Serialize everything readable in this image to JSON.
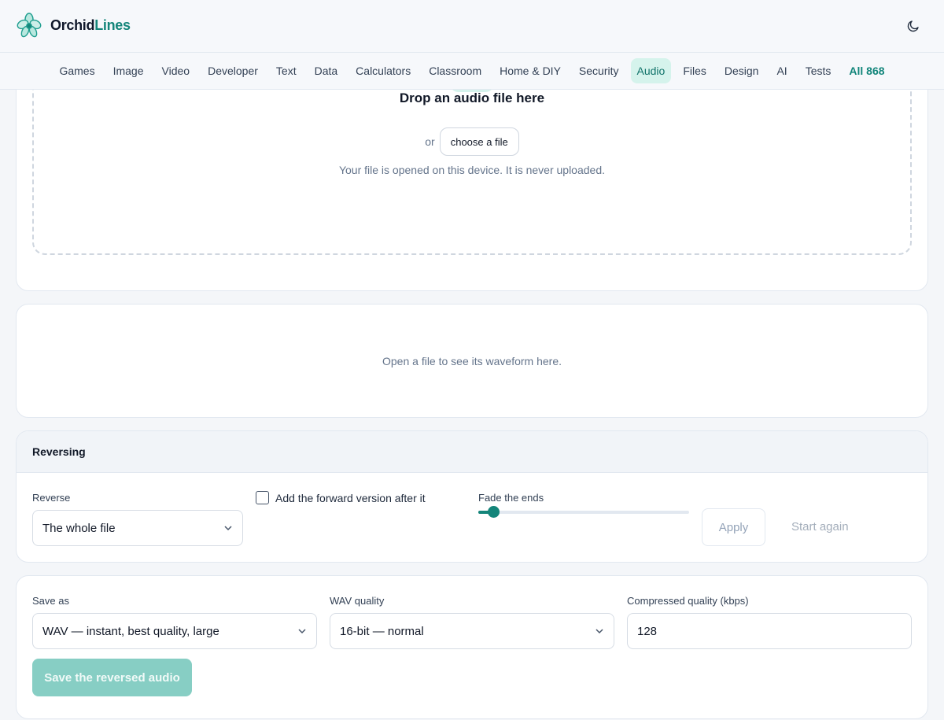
{
  "header": {
    "brand_part1": "Orchid",
    "brand_part2": "Lines",
    "theme_icon": "moon-icon"
  },
  "nav": {
    "items": [
      "Games",
      "Image",
      "Video",
      "Developer",
      "Text",
      "Data",
      "Calculators",
      "Classroom",
      "Home & DIY",
      "Security",
      "Audio",
      "Files",
      "Design",
      "AI",
      "Tests"
    ],
    "active": "Audio",
    "all_label": "All 868"
  },
  "dropzone": {
    "icon": "file-icon",
    "title": "Drop an audio file here",
    "or_text": "or",
    "choose_label": "choose a file",
    "note": "Your file is opened on this device. It is never uploaded."
  },
  "waveform": {
    "empty_text": "Open a file to see its waveform here."
  },
  "reversing": {
    "heading": "Reversing",
    "reverse_label": "Reverse",
    "reverse_value": "The whole file",
    "forward_checkbox_label": "Add the forward version after it",
    "forward_checked": false,
    "fade_label": "Fade the ends",
    "fade_level": 0.07,
    "apply_label": "Apply",
    "start_again_label": "Start again"
  },
  "save": {
    "save_as_label": "Save as",
    "save_as_value": "WAV — instant, best quality, large",
    "wav_quality_label": "WAV quality",
    "wav_quality_value": "16-bit — normal",
    "compressed_label": "Compressed quality (kbps)",
    "compressed_value": "128",
    "save_button_label": "Save the reversed audio"
  },
  "colors": {
    "accent": "#14857a",
    "accent_soft": "#d5f3ec",
    "save_disabled": "#87cec4"
  }
}
